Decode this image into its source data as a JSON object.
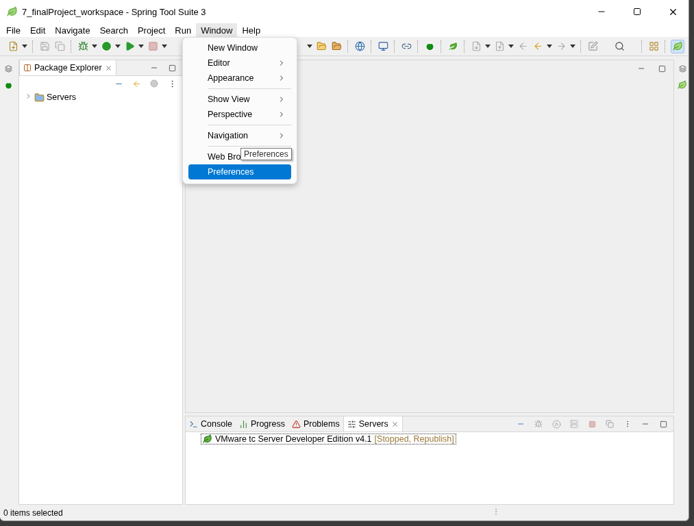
{
  "window": {
    "title": "7_finalProject_workspace - Spring Tool Suite 3"
  },
  "menu_bar": [
    {
      "label": "File",
      "selected": false
    },
    {
      "label": "Edit",
      "selected": false
    },
    {
      "label": "Navigate",
      "selected": false
    },
    {
      "label": "Search",
      "selected": false
    },
    {
      "label": "Project",
      "selected": false
    },
    {
      "label": "Run",
      "selected": false
    },
    {
      "label": "Window",
      "selected": true
    },
    {
      "label": "Help",
      "selected": false
    }
  ],
  "window_menu": {
    "items": [
      {
        "kind": "item",
        "label": "New Window",
        "submenu": false,
        "selected": false
      },
      {
        "kind": "item",
        "label": "Editor",
        "submenu": true,
        "selected": false
      },
      {
        "kind": "item",
        "label": "Appearance",
        "submenu": true,
        "selected": false
      },
      {
        "kind": "separator"
      },
      {
        "kind": "item",
        "label": "Show View",
        "submenu": true,
        "selected": false
      },
      {
        "kind": "item",
        "label": "Perspective",
        "submenu": true,
        "selected": false
      },
      {
        "kind": "separator"
      },
      {
        "kind": "item",
        "label": "Navigation",
        "submenu": true,
        "selected": false
      },
      {
        "kind": "separator"
      },
      {
        "kind": "item",
        "label": "Web Bro",
        "selected": false,
        "tooltip": "Preferences"
      },
      {
        "kind": "item",
        "label": "Preferences",
        "submenu": false,
        "selected": true
      }
    ]
  },
  "package_explorer": {
    "tab": {
      "label": "Package Explorer",
      "selected": true
    },
    "tree": [
      {
        "label": "Servers",
        "expanded": false
      }
    ]
  },
  "bottom_panel": {
    "tabs": [
      {
        "label": "Console",
        "selected": false
      },
      {
        "label": "Progress",
        "selected": false
      },
      {
        "label": "Problems",
        "selected": false
      },
      {
        "label": "Servers",
        "selected": true
      }
    ],
    "servers": [
      {
        "name": "VMware tc Server Developer Edition v4.1",
        "status": "[Stopped, Republish]"
      }
    ]
  },
  "status_bar": {
    "text": "0 items selected"
  }
}
